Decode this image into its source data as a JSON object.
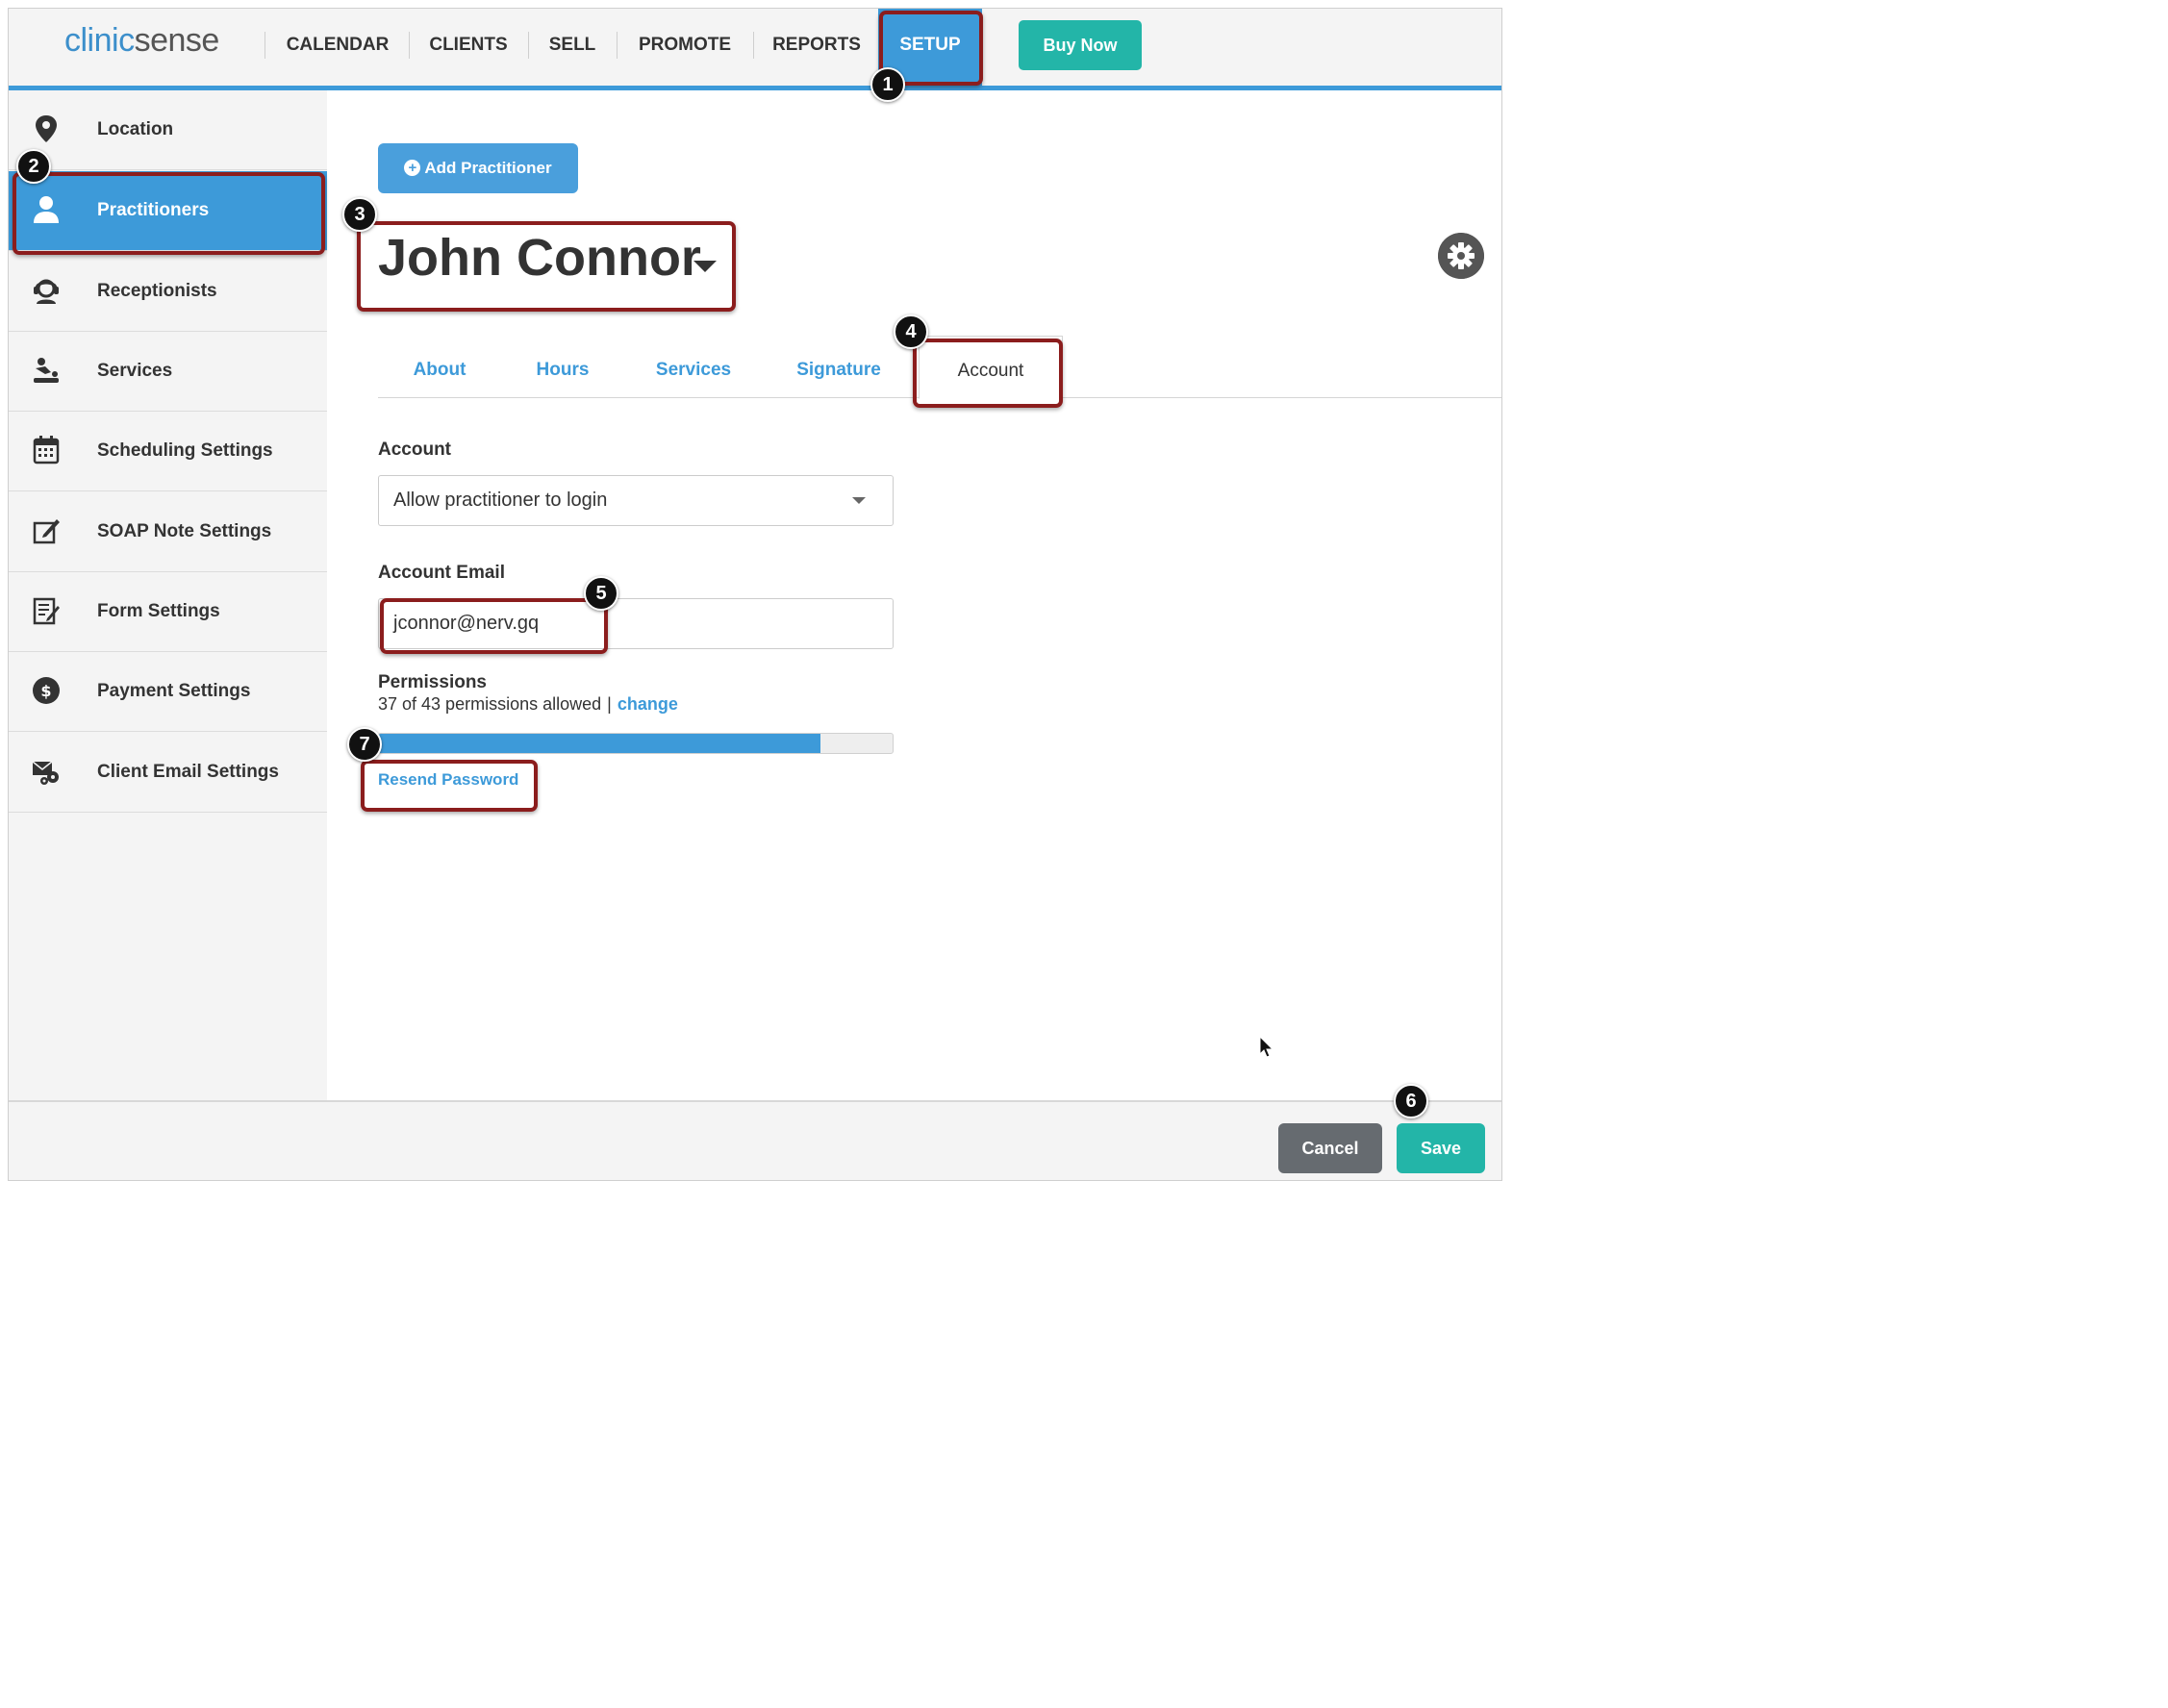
{
  "app": {
    "logo_part1": "clinic",
    "logo_part2": "sense",
    "nav": [
      "CALENDAR",
      "CLIENTS",
      "SELL",
      "PROMOTE",
      "REPORTS",
      "SETUP"
    ],
    "active_nav": "SETUP",
    "buy_now": "Buy Now",
    "accent_color": "#3d9ad9",
    "teal_color": "#23b5a8"
  },
  "sidebar": {
    "items": [
      {
        "label": "Location",
        "icon": "map-pin-icon"
      },
      {
        "label": "Practitioners",
        "icon": "user-icon"
      },
      {
        "label": "Receptionists",
        "icon": "headset-icon"
      },
      {
        "label": "Services",
        "icon": "massage-icon"
      },
      {
        "label": "Scheduling Settings",
        "icon": "calendar-icon"
      },
      {
        "label": "SOAP Note Settings",
        "icon": "edit-icon"
      },
      {
        "label": "Form Settings",
        "icon": "form-icon"
      },
      {
        "label": "Payment Settings",
        "icon": "dollar-icon"
      },
      {
        "label": "Client Email Settings",
        "icon": "email-settings-icon"
      }
    ],
    "active": "Practitioners"
  },
  "main": {
    "add_button": "Add Practitioner",
    "practitioner_name": "John Connor",
    "tabs": [
      "About",
      "Hours",
      "Services",
      "Signature",
      "Account"
    ],
    "active_tab": "Account",
    "account_label": "Account",
    "account_value": "Allow practitioner to login",
    "email_label": "Account Email",
    "email_value": "jconnor@nerv.gq",
    "permissions_label": "Permissions",
    "permissions_text": "37 of 43 permissions allowed",
    "permissions_sep": "|",
    "permissions_link": "change",
    "permissions_fraction": 0.86,
    "resend_password": "Resend Password"
  },
  "footer": {
    "cancel": "Cancel",
    "save": "Save"
  },
  "annotations": [
    "1",
    "2",
    "3",
    "4",
    "5",
    "6",
    "7"
  ]
}
